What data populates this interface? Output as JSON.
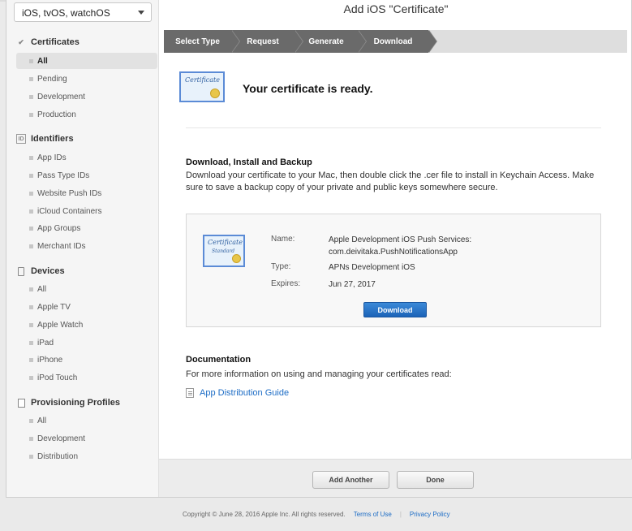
{
  "platform_select": {
    "value": "iOS, tvOS, watchOS"
  },
  "page_title": "Add iOS \"Certificate\"",
  "sidebar": {
    "sections": [
      {
        "title": "Certificates",
        "icon": "certificate-check-icon",
        "items": [
          "All",
          "Pending",
          "Development",
          "Production"
        ],
        "active": 0
      },
      {
        "title": "Identifiers",
        "icon": "id-badge-icon",
        "items": [
          "App IDs",
          "Pass Type IDs",
          "Website Push IDs",
          "iCloud Containers",
          "App Groups",
          "Merchant IDs"
        ]
      },
      {
        "title": "Devices",
        "icon": "device-icon",
        "items": [
          "All",
          "Apple TV",
          "Apple Watch",
          "iPad",
          "iPhone",
          "iPod Touch"
        ]
      },
      {
        "title": "Provisioning Profiles",
        "icon": "document-icon",
        "items": [
          "All",
          "Development",
          "Distribution"
        ]
      }
    ]
  },
  "steps": [
    "Select Type",
    "Request",
    "Generate",
    "Download"
  ],
  "ready": {
    "icon_text": "Certificate",
    "message": "Your certificate is ready."
  },
  "download_section": {
    "heading": "Download, Install and Backup",
    "text": "Download your certificate to your Mac, then double click the .cer file to install in Keychain Access. Make sure to save a backup copy of your private and public keys somewhere secure."
  },
  "certificate": {
    "icon_text": "Certificate",
    "icon_subtext": "Standard",
    "name_label": "Name:",
    "name_line1": "Apple Development iOS Push Services:",
    "name_line2": "com.deivitaka.PushNotificationsApp",
    "type_label": "Type:",
    "type_value": "APNs Development iOS",
    "expires_label": "Expires:",
    "expires_value": "Jun 27, 2017",
    "download_label": "Download"
  },
  "documentation": {
    "heading": "Documentation",
    "text": "For more information on using and managing your certificates read:",
    "link": "App Distribution Guide"
  },
  "footer_buttons": {
    "add_another": "Add Another",
    "done": "Done"
  },
  "copyright": {
    "text": "Copyright © June 28, 2016 Apple Inc. All rights reserved.",
    "terms": "Terms of Use",
    "separator": "|",
    "privacy": "Privacy Policy"
  },
  "colors": {
    "accent": "#1c6cc5",
    "step_bar": "#6a6a6a",
    "button_blue": "#1b63b8"
  }
}
